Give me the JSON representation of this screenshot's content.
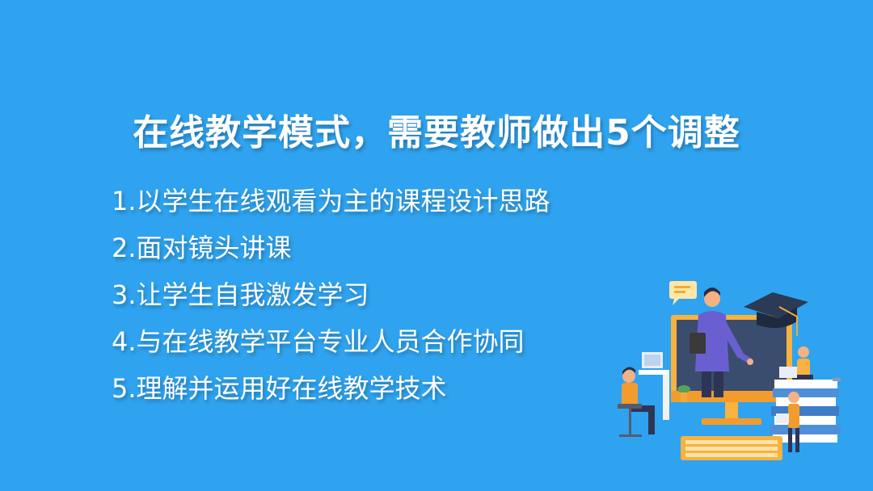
{
  "slide": {
    "title": "在线教学模式，需要教师做出5个调整",
    "items": [
      "1.以学生在线观看为主的课程设计思路",
      "2.面对镜头讲课",
      "3.让学生自我激发学习",
      "4.与在线教学平台专业人员合作协同",
      "5.理解并运用好在线教学技术"
    ]
  },
  "colors": {
    "background": "#2fa3ef",
    "text": "#ffffff"
  },
  "illustration": {
    "icons": [
      "teacher-figure",
      "monitor-icon",
      "graduation-cap-icon",
      "chat-bubble-icon",
      "book-stack-icon",
      "keyboard-icon",
      "student-figure"
    ]
  }
}
